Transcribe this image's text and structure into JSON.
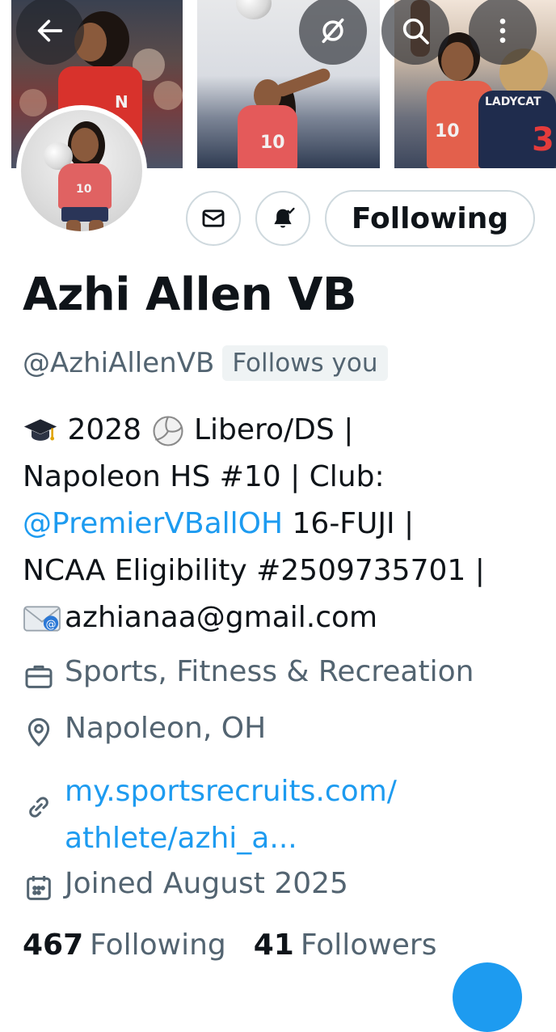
{
  "header": {
    "back_icon": "arrow-left-icon",
    "grok_icon": "grok-icon",
    "search_icon": "search-icon",
    "more_icon": "more-vertical-icon"
  },
  "profile": {
    "display_name": "Azhi Allen VB",
    "handle": "@AzhiAllenVB",
    "follows_you": "Follows you",
    "follow_button": "Following"
  },
  "bio": {
    "line1_text": " 2028 ",
    "line1_text2": " Libero/DS |",
    "line2": "Napoleon HS #10 | Club:",
    "line3_mention": "@PremierVBallOH",
    "line3_text": " 16-FUJI |",
    "line4": "NCAA Eligibility #2509735701 |",
    "line5_text": "azhianaa@gmail.com"
  },
  "meta": {
    "category": "Sports, Fitness & Recreation",
    "location": "Napoleon, OH",
    "link_line1": "my.sportsrecruits.com/",
    "link_line2": "athlete/azhi_a...",
    "joined": "Joined August 2025"
  },
  "counts": {
    "following_count": "467",
    "following_label": "Following",
    "followers_count": "41",
    "followers_label": "Followers"
  },
  "colors": {
    "accent": "#1d9bf0",
    "secondary_text": "#536471",
    "border": "#cfd9de"
  }
}
